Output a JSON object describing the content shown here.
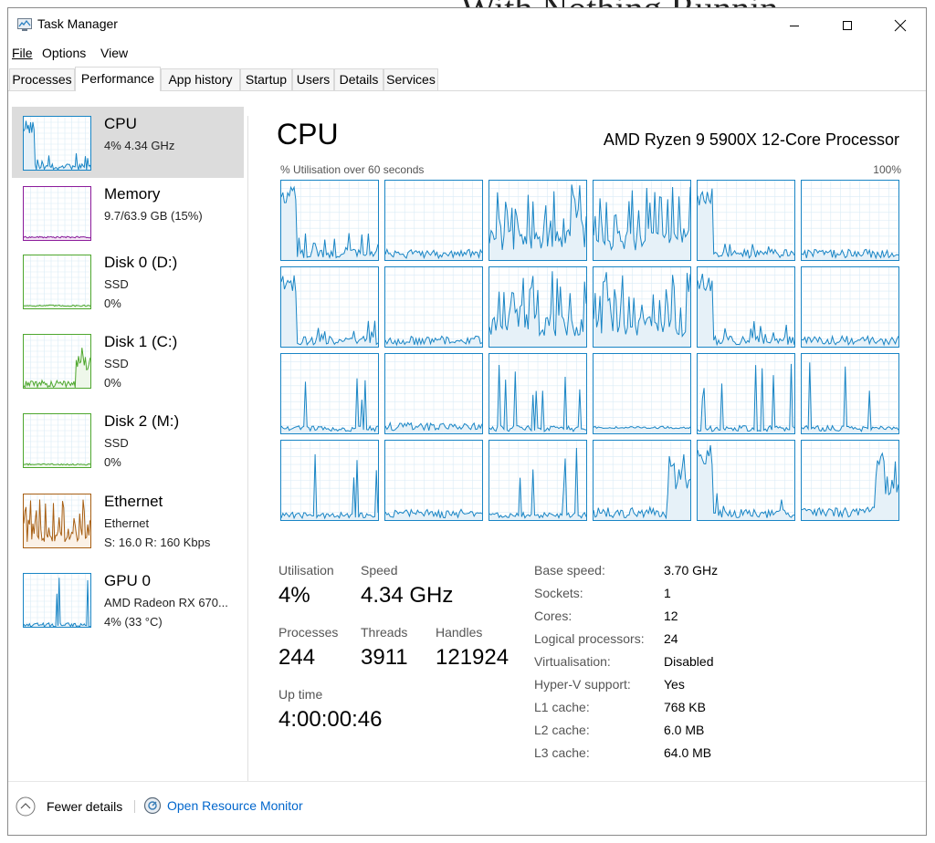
{
  "window": {
    "title": "Task Manager"
  },
  "menu": [
    "File",
    "Options",
    "View"
  ],
  "tabs": [
    "Processes",
    "Performance",
    "App history",
    "Startup",
    "Users",
    "Details",
    "Services"
  ],
  "sidebar": [
    {
      "name": "CPU",
      "line1": "4%  4.34 GHz",
      "line2": "",
      "color": "#1985c5",
      "fill": "#e6f1f8"
    },
    {
      "name": "Memory",
      "line1": "9.7/63.9 GB (15%)",
      "line2": "",
      "color": "#8b1a9a",
      "fill": "#f4e8f5"
    },
    {
      "name": "Disk 0 (D:)",
      "line1": "SSD",
      "line2": "0%",
      "color": "#4ea72e",
      "fill": "#eef7ea"
    },
    {
      "name": "Disk 1 (C:)",
      "line1": "SSD",
      "line2": "0%",
      "color": "#4ea72e",
      "fill": "#eef7ea"
    },
    {
      "name": "Disk 2 (M:)",
      "line1": "SSD",
      "line2": "0%",
      "color": "#4ea72e",
      "fill": "#eef7ea"
    },
    {
      "name": "Ethernet",
      "line1": "Ethernet",
      "line2": "S: 16.0  R: 160 Kbps",
      "color": "#a75f14",
      "fill": "#fbf1e6"
    },
    {
      "name": "GPU 0",
      "line1": "AMD Radeon RX 670...",
      "line2": "4% (33 °C)",
      "color": "#1985c5",
      "fill": "#e6f1f8"
    }
  ],
  "main": {
    "title": "CPU",
    "processor": "AMD Ryzen 9 5900X 12-Core Processor",
    "graph_label": "% Utilisation over 60 seconds",
    "graph_max": "100%"
  },
  "stats": {
    "utilisation_label": "Utilisation",
    "utilisation": "4%",
    "speed_label": "Speed",
    "speed": "4.34 GHz",
    "processes_label": "Processes",
    "processes": "244",
    "threads_label": "Threads",
    "threads": "3911",
    "handles_label": "Handles",
    "handles": "121924",
    "uptime_label": "Up time",
    "uptime": "4:00:00:46"
  },
  "specs": [
    {
      "label": "Base speed:",
      "value": "3.70 GHz"
    },
    {
      "label": "Sockets:",
      "value": "1"
    },
    {
      "label": "Cores:",
      "value": "12"
    },
    {
      "label": "Logical processors:",
      "value": "24"
    },
    {
      "label": "Virtualisation:",
      "value": "Disabled"
    },
    {
      "label": "Hyper-V support:",
      "value": "Yes"
    },
    {
      "label": "L1 cache:",
      "value": "768 KB"
    },
    {
      "label": "L2 cache:",
      "value": "6.0 MB"
    },
    {
      "label": "L3 cache:",
      "value": "64.0 MB"
    }
  ],
  "footer": {
    "fewer": "Fewer details",
    "monitor": "Open Resource Monitor"
  },
  "colors": {
    "accent": "#1985c5",
    "link": "#0066cc"
  }
}
